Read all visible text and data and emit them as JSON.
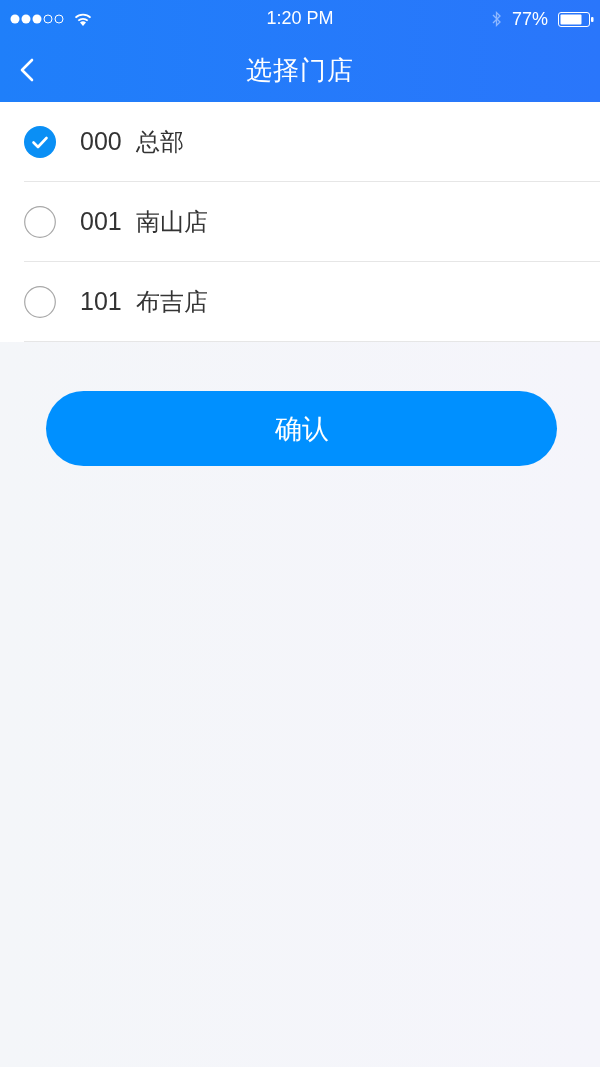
{
  "status_bar": {
    "time": "1:20 PM",
    "battery": "77%"
  },
  "nav_bar": {
    "title": "选择门店"
  },
  "stores": [
    {
      "code": "000",
      "name": "总部",
      "selected": true
    },
    {
      "code": "001",
      "name": "南山店",
      "selected": false
    },
    {
      "code": "101",
      "name": "布吉店",
      "selected": false
    }
  ],
  "confirm_button": {
    "label": "确认"
  }
}
